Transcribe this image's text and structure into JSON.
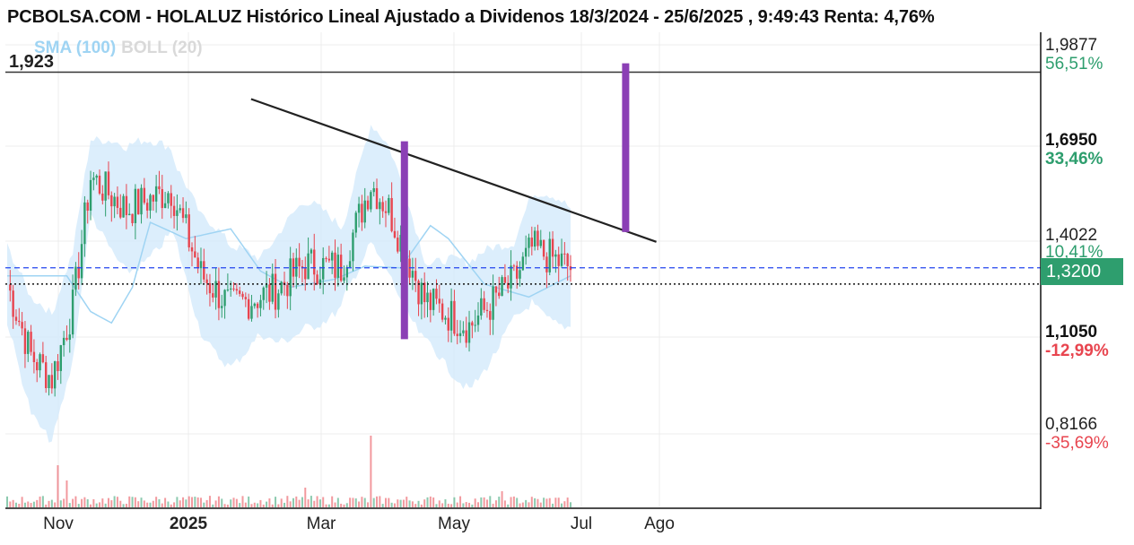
{
  "title": "PCBOLSA.COM - HOLALUZ Histórico Lineal Ajustado a Dividenos 18/3/2024 - 25/6/2025 , 9:49:43 Renta: 4,76%",
  "legend": {
    "sma": "SMA (100)",
    "boll": "BOLL (20)"
  },
  "level_label": "1,923",
  "current_price": "1,3200",
  "colors": {
    "up": "#2e9e6e",
    "down": "#e8454f",
    "sma": "#9fd4f3",
    "band": "#d6ebfb",
    "marker": "#8b3fb5",
    "dashed": "#2244ee"
  },
  "chart_data": {
    "type": "candlestick",
    "title": "PCBOLSA.COM - HOLALUZ Histórico Lineal Ajustado a Dividenos 18/3/2024 - 25/6/2025 , 9:49:43 Renta: 4,76%",
    "x_tick_labels": [
      "Nov",
      "2025",
      "Mar",
      "May",
      "Jul",
      "Ago"
    ],
    "price_levels": [
      {
        "price": "1,9877",
        "pct": "56,51%",
        "pct_color": "#2e9e6e"
      },
      {
        "price": "1,6950",
        "pct": "33,46%",
        "pct_color": "#2e9e6e"
      },
      {
        "price": "1,4022",
        "pct": "10,41%",
        "pct_color": "#2e9e6e"
      },
      {
        "price": "1,1050",
        "pct": "-12,99%",
        "pct_color": "#e8454f"
      },
      {
        "price": "0,8166",
        "pct": "-35,69%",
        "pct_color": "#e8454f"
      }
    ],
    "horizontal_level": 1.923,
    "current_price": 1.32,
    "reference_price": 1.27,
    "annotations": [
      {
        "type": "trendline",
        "from": {
          "date": "2025-01-28",
          "price": 1.84
        },
        "to": {
          "date": "2025-08-01",
          "price": 1.4
        }
      },
      {
        "type": "bar-marker",
        "date": "2025-04-08",
        "low": 1.1,
        "high": 1.71
      },
      {
        "type": "bar-marker",
        "date": "2025-07-18",
        "low": 1.43,
        "high": 1.95
      }
    ],
    "indicators": [
      "SMA (100)",
      "BOLL (20)"
    ]
  }
}
